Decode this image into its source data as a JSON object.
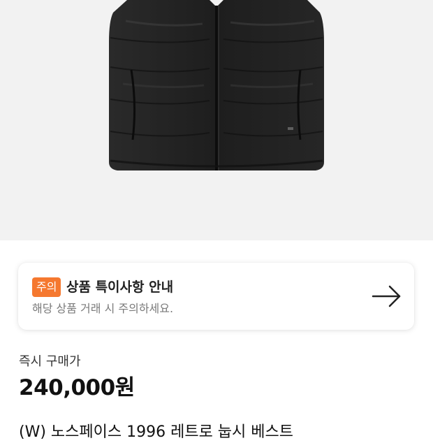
{
  "product": {
    "image_alt": "black puffer down vest",
    "title": "(W) 노스페이스 1996 레트로 눕시 베스트"
  },
  "notice": {
    "badge": "주의",
    "title": "상품 특이사항 안내",
    "subtitle": "해당 상품 거래 시 주의하세요.",
    "arrow_icon": "arrow-right-icon"
  },
  "pricing": {
    "label": "즉시 구매가",
    "price": "240,000원"
  },
  "colors": {
    "accent": "#f5782f",
    "hero_bg": "#f2f2f2",
    "vest": "#222222"
  }
}
